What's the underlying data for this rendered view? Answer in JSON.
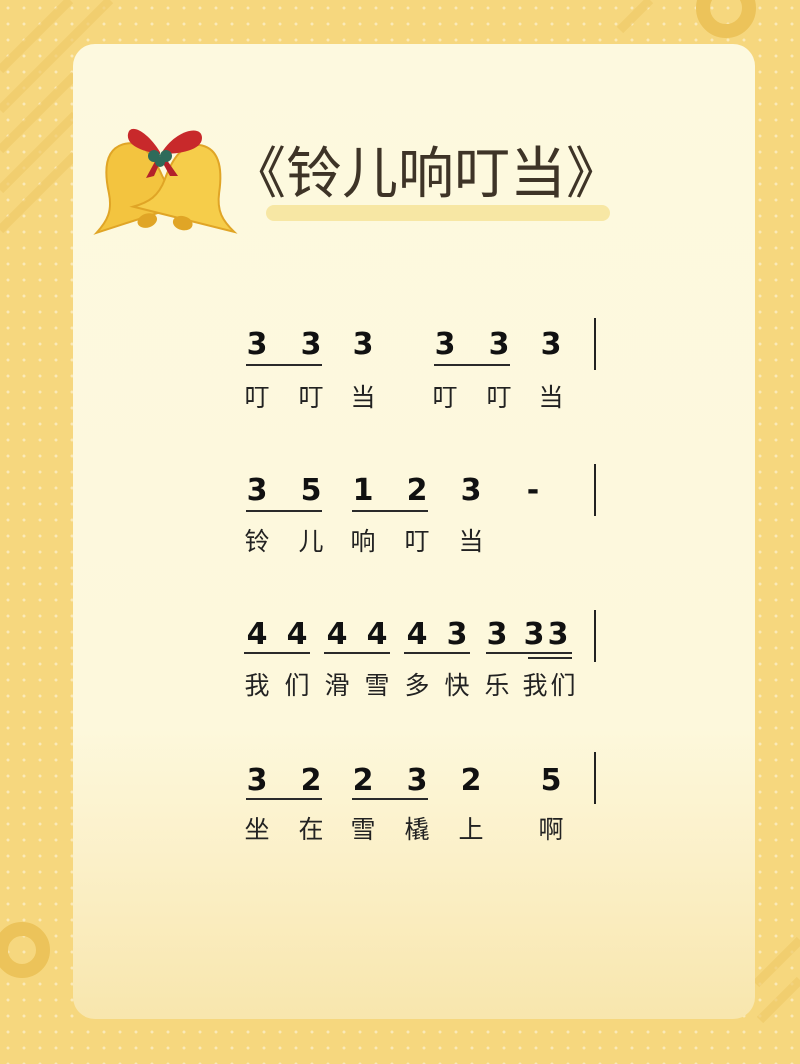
{
  "title": "《铃儿响叮当》",
  "score": [
    {
      "notes": [
        "3",
        "3",
        "3",
        "3",
        "3",
        "3"
      ],
      "lyrics": [
        "叮",
        "叮",
        "当",
        "叮",
        "叮",
        "当"
      ]
    },
    {
      "notes": [
        "3",
        "5",
        "1",
        "2",
        "3",
        "-"
      ],
      "lyrics": [
        "铃",
        "儿",
        "响",
        "叮",
        "当"
      ]
    },
    {
      "notes": [
        "4",
        "4",
        "4",
        "4",
        "4",
        "3",
        "3",
        "3",
        "3"
      ],
      "lyrics": [
        "我",
        "们",
        "滑",
        "雪",
        "多",
        "快",
        "乐",
        "我",
        "们"
      ]
    },
    {
      "notes": [
        "3",
        "2",
        "2",
        "3",
        "2",
        "5"
      ],
      "lyrics": [
        "坐",
        "在",
        "雪",
        "橇",
        "上",
        "啊"
      ]
    }
  ],
  "colors": {
    "background": "#f6d77e",
    "card": "#fdf9df",
    "title": "#3e3427",
    "bell": "#f3c43f",
    "bow": "#c8292b"
  },
  "icons": [
    "bells-icon"
  ]
}
